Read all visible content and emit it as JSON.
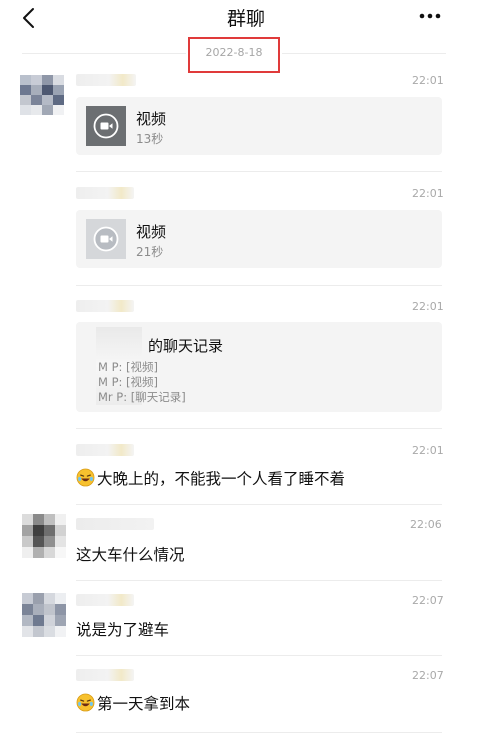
{
  "header": {
    "title": "群聊",
    "back_icon": "chevron-left-icon",
    "more_icon": "more-dots-icon"
  },
  "date_separator": "2022-8-18",
  "messages": [
    {
      "time": "22:01",
      "card": {
        "type": "video",
        "title": "视频",
        "subtitle": "13秒"
      }
    },
    {
      "time": "22:01",
      "card": {
        "type": "video",
        "title": "视频",
        "subtitle": "21秒"
      }
    },
    {
      "time": "22:01",
      "card": {
        "type": "chat-record",
        "title": "的聊天记录",
        "lines": [
          "M    P: [视频]",
          "M    P: [视频]",
          "Mr    P: [聊天记录]"
        ]
      }
    },
    {
      "time": "22:01",
      "emoji": "laughing-emoji",
      "text": "大晚上的，不能我一个人看了睡不着"
    },
    {
      "time": "22:06",
      "text": "这大车什么情况"
    },
    {
      "time": "22:07",
      "text": "说是为了避车"
    },
    {
      "time": "22:07",
      "emoji": "laughing-emoji",
      "text": "第一天拿到本"
    }
  ],
  "colors": {
    "highlight_box": "#e03a3a",
    "card_bg": "#f4f4f4",
    "timestamp": "#a9a9a9"
  }
}
